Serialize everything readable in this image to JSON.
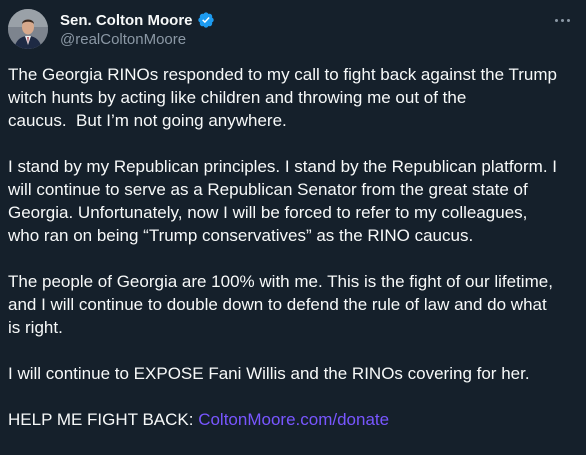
{
  "author": {
    "display_name": "Sen. Colton Moore",
    "handle": "@realColtonMoore",
    "verified": true
  },
  "post": {
    "paragraphs": [
      "The Georgia RINOs responded to my call to fight back against the Trump\nwitch hunts by acting like children and throwing me out of the\ncaucus.  But I’m not going anywhere.",
      "I stand by my Republican principles. I stand by the Republican platform. I\nwill continue to serve as a Republican Senator from the great state of\nGeorgia. Unfortunately, now I will be forced to refer to my colleagues,\nwho ran on being “Trump conservatives” as the RINO caucus.",
      "The people of Georgia are 100% with me. This is the fight of our lifetime,\nand I will continue to double down to defend the rule of law and do what\nis right.",
      "I will continue to EXPOSE Fani Willis and the RINOs covering for her."
    ],
    "cta_text": "HELP ME FIGHT BACK: ",
    "cta_link": "ColtonMoore.com/donate"
  },
  "icons": {
    "verified": "verified-badge-icon",
    "more": "more-options-icon"
  },
  "colors": {
    "background": "#15202b",
    "text": "#f7f9f9",
    "secondary_text": "#8b98a5",
    "verified_blue": "#1d9bf0",
    "link": "#7856ff"
  }
}
